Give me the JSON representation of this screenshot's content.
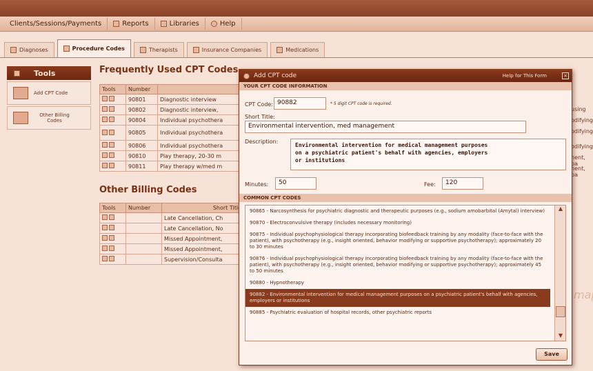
{
  "app": {
    "title": ""
  },
  "menu": [
    {
      "label": "Clients/Sessions/Payments"
    },
    {
      "label": "Reports"
    },
    {
      "label": "Libraries"
    },
    {
      "label": "Help"
    }
  ],
  "tabs": [
    {
      "label": "Diagnoses"
    },
    {
      "label": "Procedure Codes"
    },
    {
      "label": "Therapists"
    },
    {
      "label": "Insurance Companies"
    },
    {
      "label": "Medications"
    }
  ],
  "tools": {
    "header": "Tools",
    "items": [
      {
        "label": "Add CPT Code"
      },
      {
        "label": "Other Billing Codes"
      }
    ]
  },
  "frequent": {
    "title": "Frequently Used CPT Codes",
    "columns": [
      "Tools",
      "Number"
    ],
    "rows": [
      {
        "number": "90801",
        "title": "Diagnostic interview"
      },
      {
        "number": "90802",
        "title": "Diagnostic interview,"
      },
      {
        "number": "90804",
        "title": "Individual psychothera"
      },
      {
        "number": "90805",
        "title": "Individual psychothera"
      },
      {
        "number": "90806",
        "title": "Individual psychothera"
      },
      {
        "number": "90810",
        "title": "Play therapy, 20-30 m"
      },
      {
        "number": "90811",
        "title": "Play therapy w/med m"
      }
    ],
    "right_col": [
      "using",
      "odifying",
      "odifying",
      "odifying",
      "nent, pa",
      "nent, pa"
    ]
  },
  "other": {
    "title": "Other Billing Codes",
    "columns": [
      "Tools",
      "Number",
      "Short Title"
    ],
    "rows": [
      {
        "title": "Late Cancellation, Ch"
      },
      {
        "title": "Late Cancellation, No"
      },
      {
        "title": "Missed Appointment,"
      },
      {
        "title": "Missed Appointment,"
      },
      {
        "title": "Supervision/Consulta"
      }
    ]
  },
  "modal": {
    "title": "Add CPT code",
    "help": "Help for This Form",
    "section1": "YOUR CPT CODE INFORMATION",
    "cpt_label": "CPT Code:",
    "cpt_value": "90882",
    "cpt_hint": "* 5 digit CPT code is required.",
    "short_label": "Short Title:",
    "short_value": "Environmental intervention, med management",
    "desc_label": "Description:",
    "desc_value": "Environmental intervention for medical management purposes\non a psychiatric patient's behalf with agencies, employers\nor institutions",
    "minutes_label": "Minutes:",
    "minutes_value": "50",
    "fee_label": "Fee:",
    "fee_value": "120",
    "section2": "COMMON CPT CODES",
    "list": [
      "90865 - Narcosynthesis for psychiatric diagnostic and therapeutic purposes (e.g., sodium amobarbital (Amytal) interview)",
      "90870 - Electroconvulsive therapy (includes necessary monitoring)",
      "90875 - Individual psychophysiological therapy incorporating biofeedback training by any modality (face-to-face with the patient), with psychotherapy (e.g., insight oriented, behavior modifying or supportive psychotherapy); approximately 20 to 30 minutes",
      "90876 - Individual psychophysiological therapy incorporating biofeedback training by any modality (face-to-face with the patient), with psychotherapy (e.g., insight oriented, behavior modifying or supportive psychotherapy); approximately 45 to 50 minutes",
      "90880 - Hypnotherapy",
      "90882 - Environmental intervention for medical management purposes on a psychiatric patient's behalf with agencies, employers or institutions",
      "90885 - Psychiatric evaluation of hospital records, other psychiatric reports"
    ],
    "selected_index": 5,
    "save": "Save"
  }
}
